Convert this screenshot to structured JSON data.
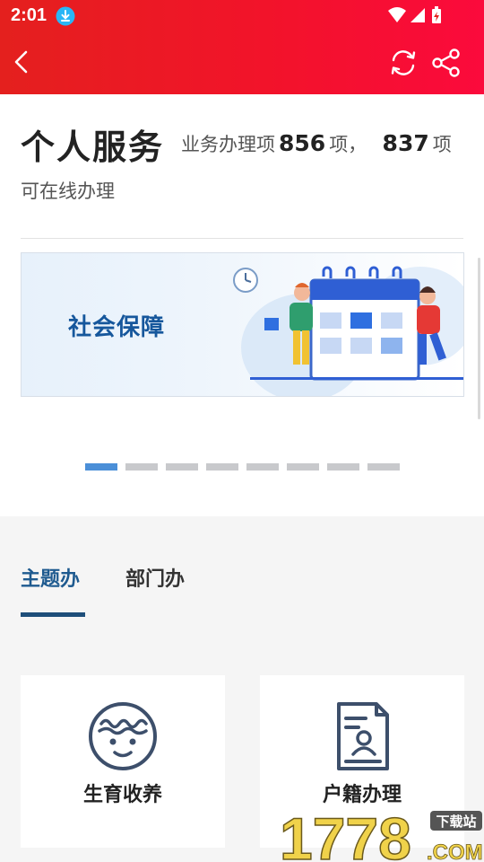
{
  "status_bar": {
    "time": "2:01"
  },
  "header": {
    "colors": {
      "start": "#e4201e",
      "end": "#fb0a3c"
    }
  },
  "service": {
    "title": "个人服务",
    "summary_prefix": "业务办理项",
    "total_count": "856",
    "separator": "项，",
    "online_count": "837",
    "suffix": "项",
    "line2": "可在线办理"
  },
  "banner": {
    "text": "社会保障",
    "slide_count": 8,
    "active_slide": 0
  },
  "tabs": [
    {
      "label": "主题办",
      "active": true
    },
    {
      "label": "部门办",
      "active": false
    }
  ],
  "cards": [
    {
      "label": "生育收养",
      "icon": "baby-face-icon"
    },
    {
      "label": "户籍办理",
      "icon": "household-register-icon"
    }
  ],
  "watermark": {
    "text": "1778",
    "badge": "下载站",
    "suffix": ".COM"
  },
  "accent": "#1e5a8f"
}
